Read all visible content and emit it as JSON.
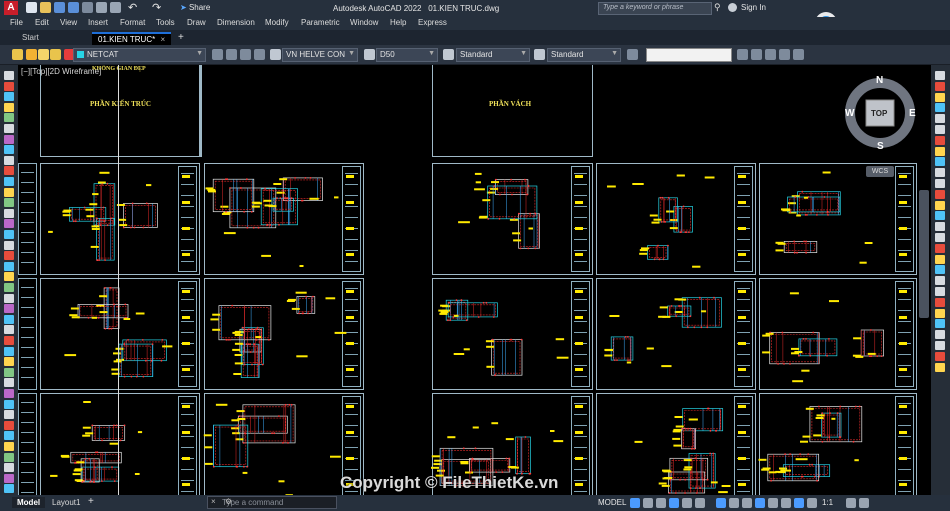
{
  "app": {
    "title": "Autodesk AutoCAD 2022",
    "file": "01.KIEN TRUC.dwg",
    "search_placeholder": "Type a keyword or phrase",
    "sign_in": "Sign In"
  },
  "menu": [
    "File",
    "Edit",
    "View",
    "Insert",
    "Format",
    "Tools",
    "Draw",
    "Dimension",
    "Modify",
    "Parametric",
    "Window",
    "Help",
    "Express"
  ],
  "quick_access": {
    "share_label": "Share"
  },
  "tabs": {
    "start": "Start",
    "active": "01.KIEN TRUC*"
  },
  "properties_bar": {
    "layer": "NETCAT",
    "text_style": "VN HELVE CON",
    "dim_style": "D50",
    "table_style": "Standard",
    "mleader_style": "Standard"
  },
  "viewport_label": "[−][Top][2D Wireframe]",
  "viewcube": {
    "n": "N",
    "s": "S",
    "e": "E",
    "w": "W",
    "face": "TOP",
    "wcs": "WCS"
  },
  "drawing_labels": {
    "upper_title": "KHÔNG GIAN ĐẸP",
    "left_title": "PHẦN KIẾN TRÚC",
    "right_title": "PHẦN VÁCH"
  },
  "command_line": {
    "placeholder": "Type a command"
  },
  "layout_tabs": [
    "Model",
    "Layout1"
  ],
  "status": {
    "mode": "MODEL",
    "scale": "1:1"
  },
  "watermark": {
    "copyright": "Copyright © FileThietKe.vn",
    "logo_text": "File Thiết Kế .vn"
  },
  "colors": {
    "accent_blue": "#1e6fd9",
    "sheet_border": "#9fb9c7",
    "cad_red": "#e52b2b",
    "cad_yellow": "#ffea00",
    "cad_cyan": "#27d5e6"
  }
}
